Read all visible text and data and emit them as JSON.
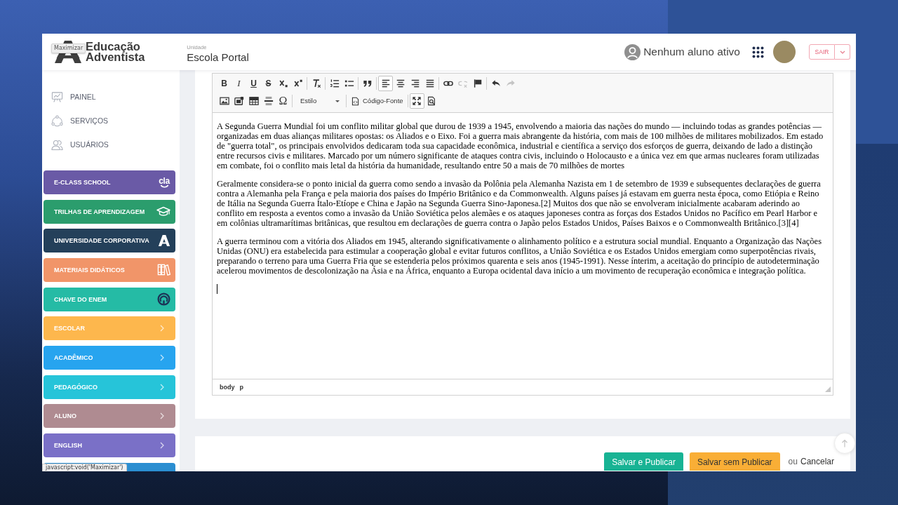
{
  "header": {
    "tooltip": "Maximizar",
    "logo_lines": [
      "Educação",
      "Adventista"
    ],
    "unit_label": "Unidade",
    "unit_name": "Escola Portal",
    "student_status": "Nenhum aluno ativo",
    "logout": "SAIR"
  },
  "sidebar": {
    "links": [
      {
        "kind": "dashboard",
        "label": "PAINEL"
      },
      {
        "kind": "services",
        "label": "SERVIÇOS"
      },
      {
        "kind": "users",
        "label": "USUÁRIOS"
      }
    ],
    "modules": [
      {
        "kind": "eclass",
        "label": "E-CLASS SCHOOL",
        "badge": "cla",
        "color": "#6a5aa6"
      },
      {
        "kind": "course",
        "label": "TRILHAS DE APRENDIZAGEM",
        "color": "#2b9d6d"
      },
      {
        "kind": "corporate",
        "label": "UNIVERSIDADE CORPORATIVA",
        "color": "#24405a"
      },
      {
        "kind": "library",
        "label": "MATERIAIS DIDÁTICOS",
        "color": "#f19569"
      },
      {
        "kind": "enem",
        "label": "CHAVE DO ENEM",
        "color": "#25bba5"
      },
      {
        "kind": "submenu",
        "label": "ESCOLAR",
        "color": "#fdb74d"
      },
      {
        "kind": "submenu",
        "label": "ACADÊMICO",
        "color": "#27a4ef"
      },
      {
        "kind": "submenu",
        "label": "PEDAGÓGICO",
        "color": "#26c4d9"
      },
      {
        "kind": "submenu",
        "label": "ALUNO",
        "color": "#af8b91"
      },
      {
        "kind": "submenu",
        "label": "ENGLISH",
        "color": "#7a70c7"
      },
      {
        "color": "#2b8ed1"
      }
    ]
  },
  "status_link": "javascript:void('Maximizar')",
  "editor": {
    "toolbar": [
      {
        "items": [
          {
            "kind": "bold",
            "label": "B",
            "selected": false,
            "disabled": false
          },
          {
            "kind": "italic",
            "label": "I",
            "selected": false,
            "disabled": false
          },
          {
            "kind": "underline",
            "label": "U",
            "selected": false,
            "disabled": false
          },
          {
            "kind": "strike",
            "label": "S",
            "selected": false,
            "disabled": false
          },
          {
            "kind": "subscript",
            "selected": false,
            "disabled": false
          },
          {
            "kind": "superscript",
            "selected": false,
            "disabled": false
          },
          {
            "kind": "separator"
          },
          {
            "kind": "clearformat",
            "selected": false,
            "disabled": false
          },
          {
            "kind": "separator"
          },
          {
            "kind": "numbered",
            "selected": false,
            "disabled": false
          },
          {
            "kind": "bulleted",
            "selected": false,
            "disabled": false
          },
          {
            "kind": "separator"
          },
          {
            "kind": "quote",
            "selected": false,
            "disabled": false
          },
          {
            "kind": "separator"
          },
          {
            "kind": "alignleft",
            "selected": true,
            "disabled": false
          },
          {
            "kind": "center",
            "selected": false,
            "disabled": false
          },
          {
            "kind": "alignright",
            "selected": false,
            "disabled": false
          },
          {
            "kind": "justify",
            "selected": false,
            "disabled": false
          },
          {
            "kind": "separator"
          },
          {
            "kind": "link",
            "selected": false,
            "disabled": false
          },
          {
            "kind": "unlink",
            "selected": false,
            "disabled": true
          },
          {
            "kind": "anchor",
            "selected": false,
            "disabled": false
          },
          {
            "kind": "separator"
          },
          {
            "kind": "undo",
            "selected": false,
            "disabled": false
          },
          {
            "kind": "redo",
            "selected": false,
            "disabled": true
          }
        ]
      },
      {
        "items": [
          {
            "kind": "image",
            "selected": false,
            "disabled": false
          },
          {
            "kind": "media",
            "selected": false,
            "disabled": false
          },
          {
            "kind": "table",
            "selected": false,
            "disabled": false
          },
          {
            "kind": "rule",
            "selected": false,
            "disabled": false
          },
          {
            "kind": "symbol",
            "label": "Ω",
            "selected": false,
            "disabled": false
          },
          {
            "kind": "separator"
          },
          {
            "kind": "format",
            "label": "Estilo",
            "selected": false,
            "disabled": false
          },
          {
            "kind": "separator"
          },
          {
            "kind": "source",
            "label": "Código-Fonte",
            "selected": false,
            "disabled": false
          },
          {
            "kind": "separator"
          },
          {
            "kind": "maximize",
            "selected": true,
            "disabled": false
          },
          {
            "kind": "preview",
            "selected": false,
            "disabled": false
          }
        ]
      }
    ],
    "paragraphs": [
      "A Segunda Guerra Mundial foi um conflito militar global que durou de 1939 a 1945, envolvendo a maioria das nações do mundo — incluindo todas as grandes potências — organizadas em duas alianças militares opostas: os Aliados e o Eixo. Foi a guerra mais abrangente da história, com mais de 100 milhões de militares mobilizados. Em estado de \"guerra total\", os principais envolvidos dedicaram toda sua capacidade econômica, industrial e científica a serviço dos esforços de guerra, deixando de lado a distinção entre recursos civis e militares. Marcado por um número significante de ataques contra civis, incluindo o Holocausto e a única vez em que armas nucleares foram utilizadas em combate, foi o conflito mais letal da história da humanidade, resultando entre 50 a mais de 70 milhões de mortes",
      "Geralmente considera-se o ponto inicial da guerra como sendo a invasão da Polônia pela Alemanha Nazista em 1 de setembro de 1939 e subsequentes declarações de guerra contra a Alemanha pela França e pela maioria dos países do Império Britânico e da Commonwealth. Alguns países já estavam em guerra nesta época, como Etiópia e Reino de Itália na Segunda Guerra Ítalo-Etíope e China e Japão na Segunda Guerra Sino-Japonesa.[2] Muitos dos que não se envolveram inicialmente acabaram aderindo ao conflito em resposta a eventos como a invasão da União Soviética pelos alemães e os ataques japoneses contra as forças dos Estados Unidos no Pacífico em Pearl Harbor e em colônias ultramarítimas britânicas, que resultou em declarações de guerra contra o Japão pelos Estados Unidos, Países Baixos e o Commonwealth Britânico.[3][4]",
      "A guerra terminou com a vitória dos Aliados em 1945, alterando significativamente o alinhamento político e a estrutura social mundial. Enquanto a Organização das Nações Unidas (ONU) era estabelecida para estimular a cooperação global e evitar futuros conflitos, a União Soviética e os Estados Unidos emergiam como superpotências rivais, preparando o terreno para uma Guerra Fria que se estenderia pelos próximos quarenta e seis anos (1945-1991). Nesse ínterim, a aceitação do princípio de autodeterminação acelerou movimentos de descolonização na Ásia e na África, enquanto a Europa ocidental dava início a um movimento de recuperação econômica e integração política."
    ],
    "path": [
      "body",
      "p"
    ]
  },
  "footer": {
    "actions": [
      {
        "label": "Salvar e Publicar",
        "color": "#18b394"
      },
      {
        "label": "Salvar sem Publicar",
        "color": "#f9ae36"
      }
    ],
    "cancel_prefix": "ou",
    "cancel": "Cancelar"
  }
}
